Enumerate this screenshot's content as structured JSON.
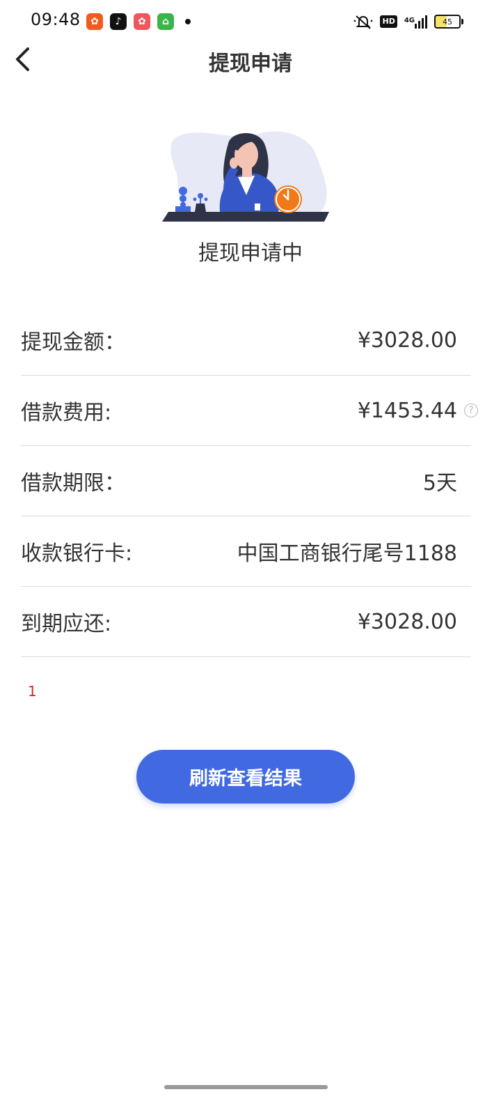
{
  "status_bar": {
    "time": "09:48",
    "network": "4G",
    "hd": "HD",
    "battery": "45"
  },
  "nav": {
    "title": "提现申请"
  },
  "status": {
    "text": "提现申请中"
  },
  "details": [
    {
      "label": "提现金额：",
      "value": "¥3028.00"
    },
    {
      "label": "借款费用:",
      "value": "¥1453.44"
    },
    {
      "label": "借款期限：",
      "value": "5天"
    },
    {
      "label": "收款银行卡:",
      "value": "中国工商银行尾号1188"
    },
    {
      "label": "到期应还:",
      "value": "¥3028.00"
    }
  ],
  "note": "1",
  "actions": {
    "refresh_label": "刷新查看结果"
  },
  "colors": {
    "primary": "#4169e1",
    "note": "#e02020",
    "accent_orange": "#f07a1a"
  }
}
